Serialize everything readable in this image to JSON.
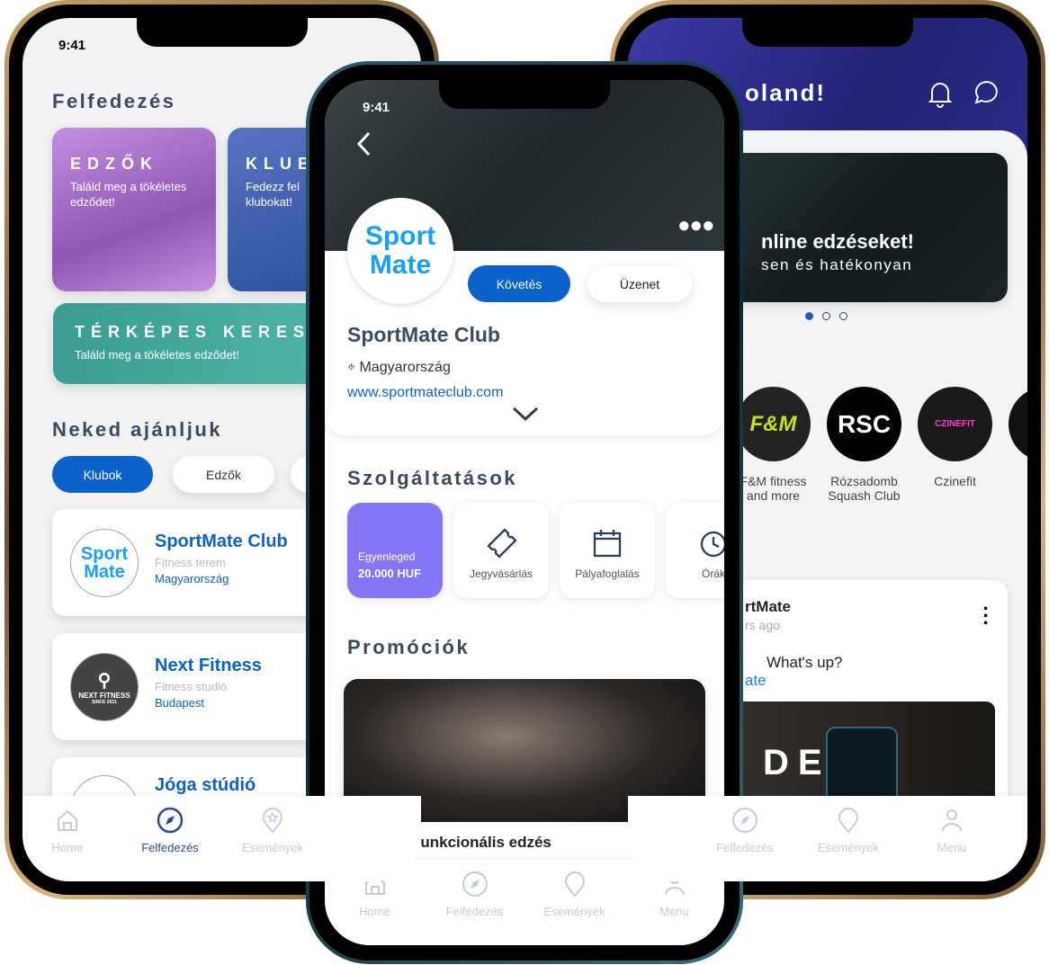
{
  "status_time": "9:41",
  "left": {
    "title": "Felfedezés",
    "tiles": [
      {
        "title": "EDZŐK",
        "subtitle": "Találd meg a tökéletes edződet!",
        "color": "#b67fd6"
      },
      {
        "title": "KLUB",
        "subtitle": "Fedezz fel klubokat!",
        "color": "#3b5bb0"
      },
      {
        "title": "TÉRKÉPES KERESÉ",
        "subtitle": "Találd meg a tökéletes edződet!",
        "color": "#3fa79e"
      }
    ],
    "recommend_title": "Neked ajánljuk",
    "chips": [
      "Klubok",
      "Edzők"
    ],
    "clubs": [
      {
        "name": "SportMate Club",
        "type": "Fitness terem",
        "location": "Magyarország",
        "logo": "Sport Mate"
      },
      {
        "name": "Next Fitness",
        "type": "Fitness studió",
        "location": "Budapest",
        "logo": "NEXT FITNESS",
        "logo_sub": "SINCE 2021"
      },
      {
        "name": "Jóga stúdió"
      }
    ],
    "tabs": [
      "Home",
      "Felfedezés",
      "Események"
    ]
  },
  "middle": {
    "logo_line1": "Sport",
    "logo_line2": "Mate",
    "follow": "Követés",
    "message": "Üzenet",
    "club_name": "SportMate Club",
    "location": "Magyarország",
    "website": "www.sportmateclub.com",
    "services_title": "Szolgáltatások",
    "balance_label": "Egyenleged",
    "balance_value": "20.000 HUF",
    "services": [
      "Jegyvásárlás",
      "Pályafoglalás",
      "Órák"
    ],
    "promo_title": "Promóciók",
    "promo_name": "Funkcionális edzés",
    "tabs": [
      "Home",
      "Felfedezés",
      "Események",
      "Menu"
    ],
    "accent": "#0b62c8",
    "balance_color": "#8477f7"
  },
  "right": {
    "greeting": "oland!",
    "banner_title": "nline edzéseket!",
    "banner_sub": "sen és hatékonyan",
    "clubs": [
      {
        "name": "F&M fitness and more",
        "logo": "F&M"
      },
      {
        "name": "Rózsadomb Squash Club",
        "logo": "RSC"
      },
      {
        "name": "Czinefit",
        "logo": "CZINEFIT"
      }
    ],
    "post_author": "rtMate",
    "post_time": "rs ago",
    "post_text": "What's up?",
    "post_link": "ate",
    "post_image_text": "DEN,",
    "tabs": [
      "Felfedezés",
      "Események",
      "Menu"
    ]
  }
}
